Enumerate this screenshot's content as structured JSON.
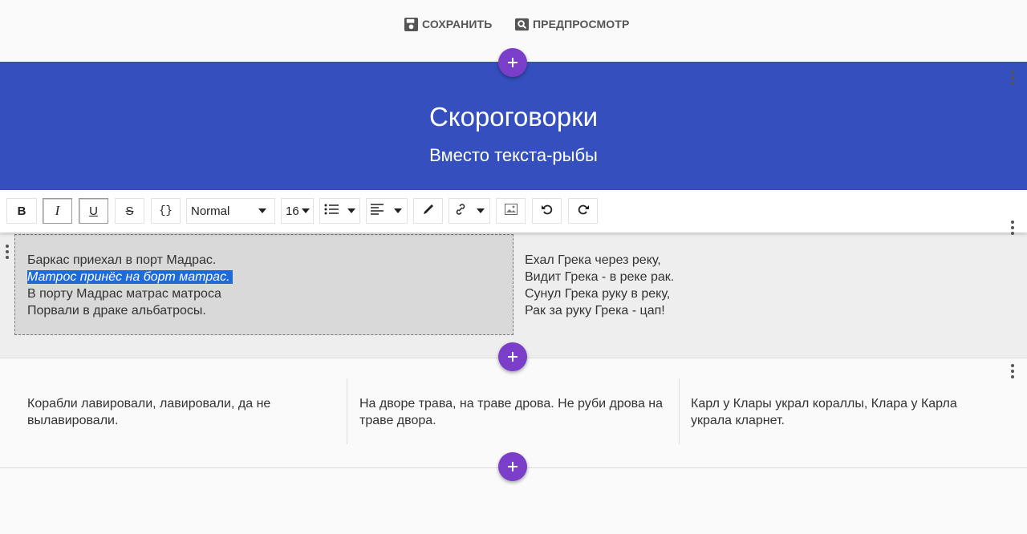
{
  "toolbar": {
    "save_label": "СОХРАНИТЬ",
    "preview_label": "ПРЕДПРОСМОТР"
  },
  "hero": {
    "title": "Скороговорки",
    "subtitle": "Вместо текста-рыбы"
  },
  "editor": {
    "bold": "B",
    "italic": "I",
    "underline": "U",
    "strike": "S",
    "code": "{}",
    "block_style": "Normal",
    "font_size": "16"
  },
  "section1": {
    "col1": {
      "line1": "Баркас приехал в порт Мадрас.",
      "line2_selected": "Матрос принёс на борт матрас.",
      "line3": "В порту Мадрас матрас матроса",
      "line4": "Порвали в драке альбатросы."
    },
    "col2": {
      "line1": "Ехал Грека через реку,",
      "line2": "Видит Грека - в реке рак.",
      "line3": "Сунул Грека руку в реку,",
      "line4": "Рак за руку Грека - цап!"
    }
  },
  "section2": {
    "col1": "Корабли лавировали, лавировали, да не вылавировали.",
    "col2": "На дворе трава, на траве дрова. Не руби дрова на траве двора.",
    "col3": "Карл у Клары украл кораллы, Клара у Карла украла кларнет."
  },
  "colors": {
    "hero": "#3550be",
    "fab": "#7b3ec9",
    "selection": "#1e6ad8"
  }
}
